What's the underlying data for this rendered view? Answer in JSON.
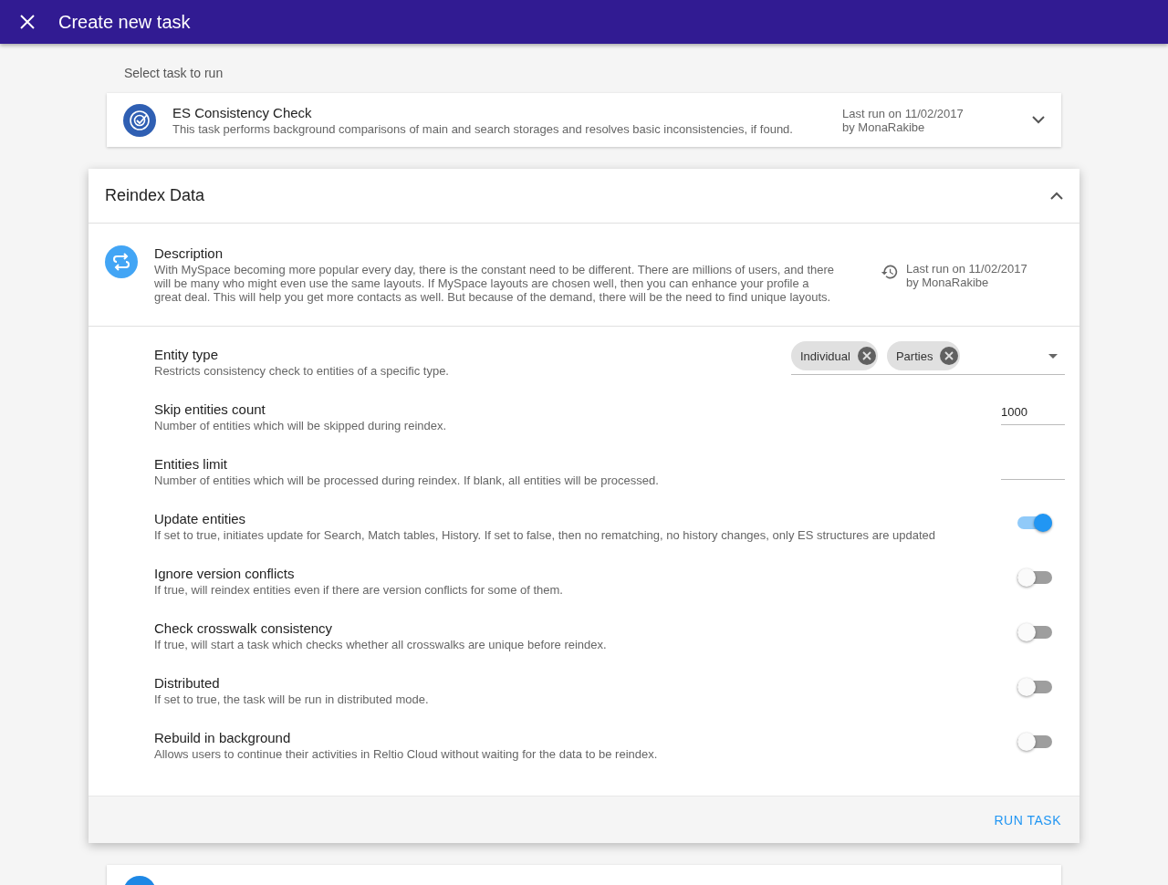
{
  "app_bar": {
    "title": "Create new task"
  },
  "section_label": "Select task to run",
  "collapsed_task": {
    "title": "ES Consistency Check",
    "description": "This task performs background comparisons of main and search storages and resolves basic inconsistencies, if found.",
    "last_run": "Last run on 11/02/2017",
    "by": "by MonaRakibe",
    "expanded": false
  },
  "expanded_task": {
    "title": "Reindex Data",
    "expanded": true,
    "description_title": "Description",
    "description": "With MySpace becoming more popular every day, there is the constant need to be different. There are millions of users, and there will be many who might even use the same layouts. If MySpace layouts are chosen well, then you can enhance your profile a great deal. This will help you get more contacts as well. But because of the demand, there will be the need to find unique layouts.",
    "last_run": "Last run on 11/02/2017",
    "by": "by MonaRakibe",
    "settings": [
      {
        "kind": "chips",
        "label": "Entity type",
        "hint": "Restricts consistency check to entities of a specific type.",
        "chips": [
          "Individual",
          "Parties"
        ]
      },
      {
        "kind": "input",
        "label": "Skip entities count",
        "hint": "Number of entities which will be skipped during reindex.",
        "value": "1000"
      },
      {
        "kind": "input",
        "label": "Entities limit",
        "hint": "Number of entities which will be processed during reindex. If blank, all entities will be processed."
      },
      {
        "kind": "toggle",
        "label": "Update entities",
        "hint": "If set to true, initiates update for Search, Match tables, History. If set to false, then no rematching, no history changes, only ES structures are updated",
        "on": true
      },
      {
        "kind": "toggle",
        "label": "Ignore version conflicts",
        "hint": "If true, will reindex entities even if there are version conflicts for some of them.",
        "on": false
      },
      {
        "kind": "toggle",
        "label": "Check crosswalk consistency",
        "hint": "If true, will start a task which checks whether all crosswalks are unique before reindex.",
        "on": false
      },
      {
        "kind": "toggle",
        "label": "Distributed",
        "hint": "If set to true, the task will be run in distributed mode.",
        "on": false
      },
      {
        "kind": "toggle",
        "label": "Rebuild in background",
        "hint": "Allows users to continue their activities in Reltio Cloud without waiting for the data to be reindex.",
        "on": false
      }
    ],
    "run_button": "RUN TASK"
  }
}
